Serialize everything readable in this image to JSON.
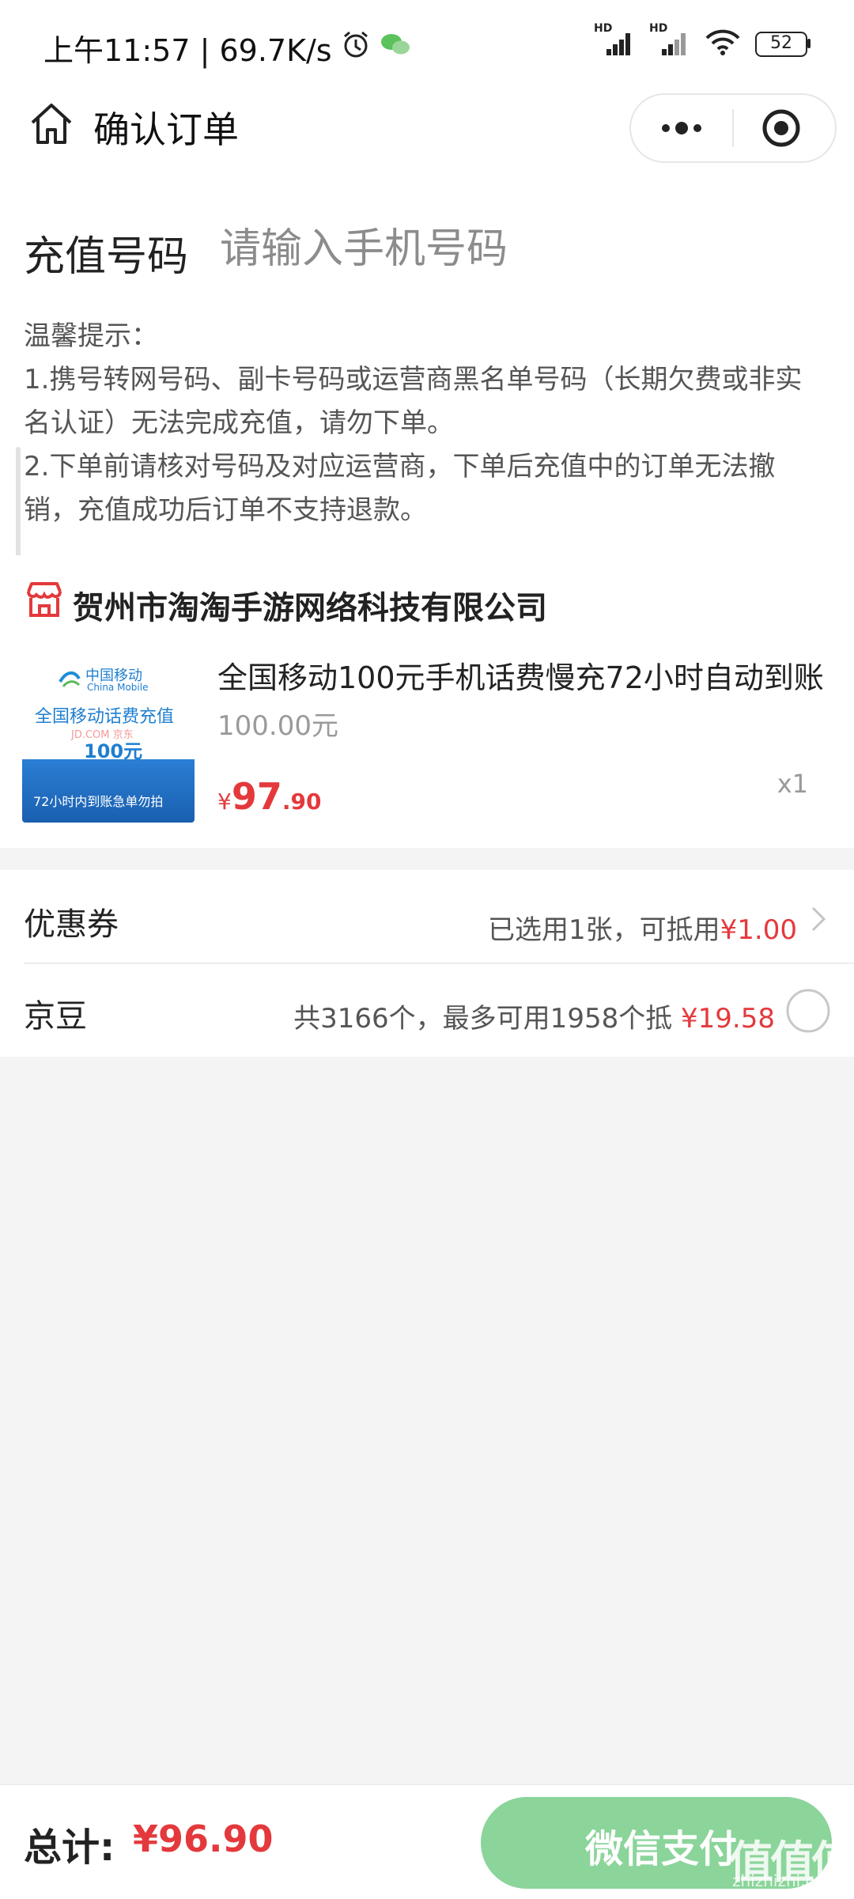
{
  "status_bar": {
    "time_speed": "上午11:57 | 69.7K/s",
    "net1": "HD",
    "net2": "HD",
    "battery": "52"
  },
  "nav": {
    "title": "确认订单",
    "home_icon": "home-icon",
    "more_icon": "more-dots-icon",
    "close_icon": "target-close-icon"
  },
  "recharge": {
    "label": "充值号码",
    "placeholder": "请输入手机号码"
  },
  "tips": {
    "title": "温馨提示：",
    "line1": "1.携号转网号码、副卡号码或运营商黑名单号码（长期欠费或非实名认证）无法完成充值，请勿下单。",
    "line2": "2.下单前请核对号码及对应运营商，下单后充值中的订单无法撤销，充值成功后订单不支持退款。"
  },
  "store": {
    "name": "贺州市淘淘手游网络科技有限公司",
    "icon": "store-icon"
  },
  "product": {
    "image": {
      "brand_cn": "中国移动",
      "brand_en": "China Mobile",
      "headline": "全国移动话费充值",
      "watermark": "JD.COM 京东",
      "amount": "100元",
      "footer": "72小时内到账急单勿拍"
    },
    "title": "全国移动100元手机话费慢充72小时自动到账",
    "original_price": "100.00元",
    "price_symbol": "¥",
    "price_int": "97",
    "price_dec": ".90",
    "quantity": "x1"
  },
  "coupon": {
    "label": "优惠券",
    "desc": "已选用1张，可抵用",
    "amount": "¥1.00",
    "arrow_icon": "chevron-right-icon"
  },
  "jingdou": {
    "label": "京豆",
    "desc": "共3166个，最多可用1958个抵",
    "amount": "¥19.58",
    "radio_icon": "radio-unchecked-icon"
  },
  "footer": {
    "total_label": "总计:",
    "total_amount": "¥96.90",
    "pay_label": "微信支付",
    "watermark": "值值值",
    "watermark_sub": "zhizhizhi.com"
  },
  "colors": {
    "accent_red": "#e4393c",
    "pay_green": "#8bd49a"
  }
}
